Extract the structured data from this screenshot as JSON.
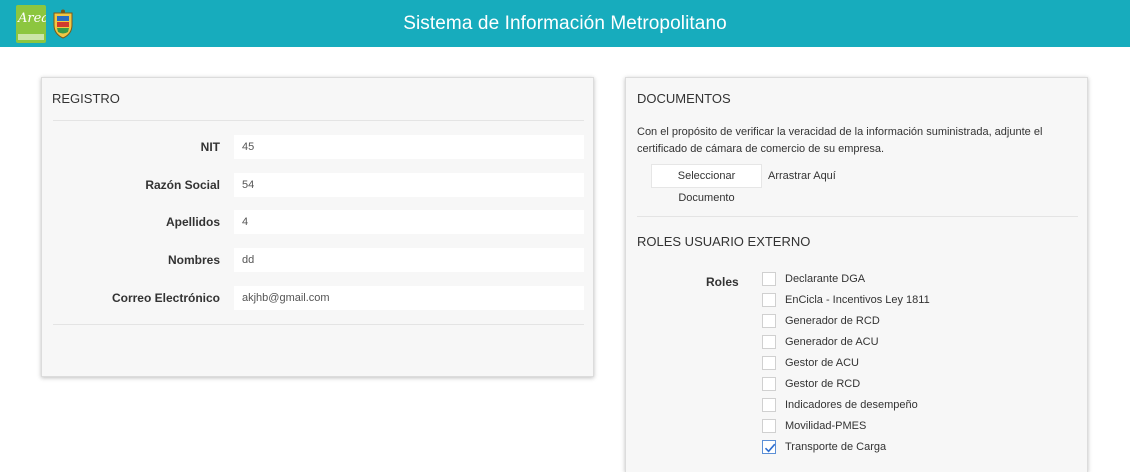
{
  "header": {
    "title": "Sistema de Información Metropolitano",
    "logo_text": "Area",
    "brand_color": "#17acbd"
  },
  "registro": {
    "title": "REGISTRO",
    "fields": [
      {
        "label": "NIT",
        "value": "45"
      },
      {
        "label": "Razón Social",
        "value": "54"
      },
      {
        "label": "Apellidos",
        "value": "4"
      },
      {
        "label": "Nombres",
        "value": "dd"
      },
      {
        "label": "Correo Electrónico",
        "value": "akjhb@gmail.com"
      }
    ]
  },
  "documentos": {
    "title": "DOCUMENTOS",
    "description": "Con el propósito de verificar la veracidad de la información suministrada, adjunte el certificado de cámara de comercio de su empresa.",
    "select_button": "Seleccionar Documento",
    "drag_text": "Arrastrar Aquí"
  },
  "roles": {
    "title": "ROLES USUARIO EXTERNO",
    "label": "Roles",
    "items": [
      {
        "label": "Declarante DGA",
        "checked": false
      },
      {
        "label": "EnCicla - Incentivos Ley 1811",
        "checked": false
      },
      {
        "label": "Generador  de RCD",
        "checked": false
      },
      {
        "label": "Generador de ACU",
        "checked": false
      },
      {
        "label": "Gestor de ACU",
        "checked": false
      },
      {
        "label": "Gestor de RCD",
        "checked": false
      },
      {
        "label": "Indicadores de desempeño",
        "checked": false
      },
      {
        "label": "Movilidad-PMES",
        "checked": false
      },
      {
        "label": "Transporte de Carga",
        "checked": true
      }
    ]
  }
}
